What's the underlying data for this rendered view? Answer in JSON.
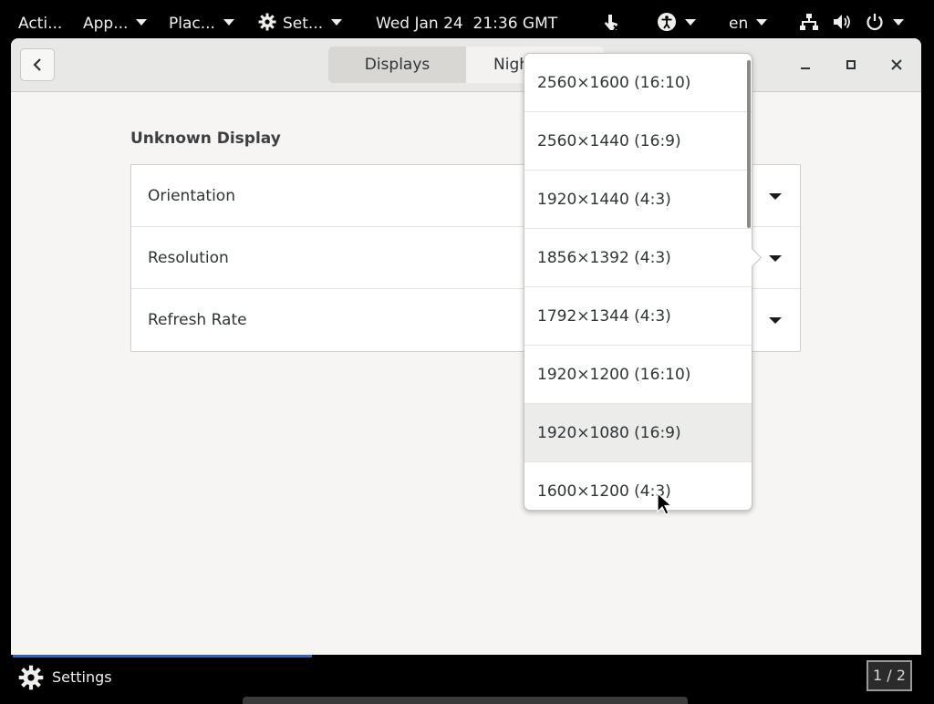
{
  "topbar": {
    "activities": "Acti...",
    "applications": "App...",
    "places": "Plac...",
    "settings_menu": "Set...",
    "clock": "Wed Jan 24  21:36 GMT",
    "language": "en"
  },
  "window": {
    "tabs": [
      {
        "label": "Displays"
      },
      {
        "label": "Nigh"
      }
    ],
    "section_title": "Unknown Display",
    "rows": [
      {
        "label": "Orientation"
      },
      {
        "label": "Resolution"
      },
      {
        "label": "Refresh Rate"
      }
    ]
  },
  "popover": {
    "options": [
      {
        "label": "2560×1600 (16:10)"
      },
      {
        "label": "2560×1440 (16:9)"
      },
      {
        "label": "1920×1440 (4:3)"
      },
      {
        "label": "1856×1392 (4:3)"
      },
      {
        "label": "1792×1344 (4:3)"
      },
      {
        "label": "1920×1200 (16:10)"
      },
      {
        "label": "1920×1080 (16:9)"
      },
      {
        "label": "1600×1200 (4:3)"
      }
    ],
    "hovered": "1920×1080 (16:9)"
  },
  "taskbar": {
    "app_label": "Settings",
    "workspace": "1 / 2"
  },
  "colors": {
    "accent": "#3465a4",
    "window_bg": "#f6f5f4",
    "panel_bg": "#000000"
  }
}
